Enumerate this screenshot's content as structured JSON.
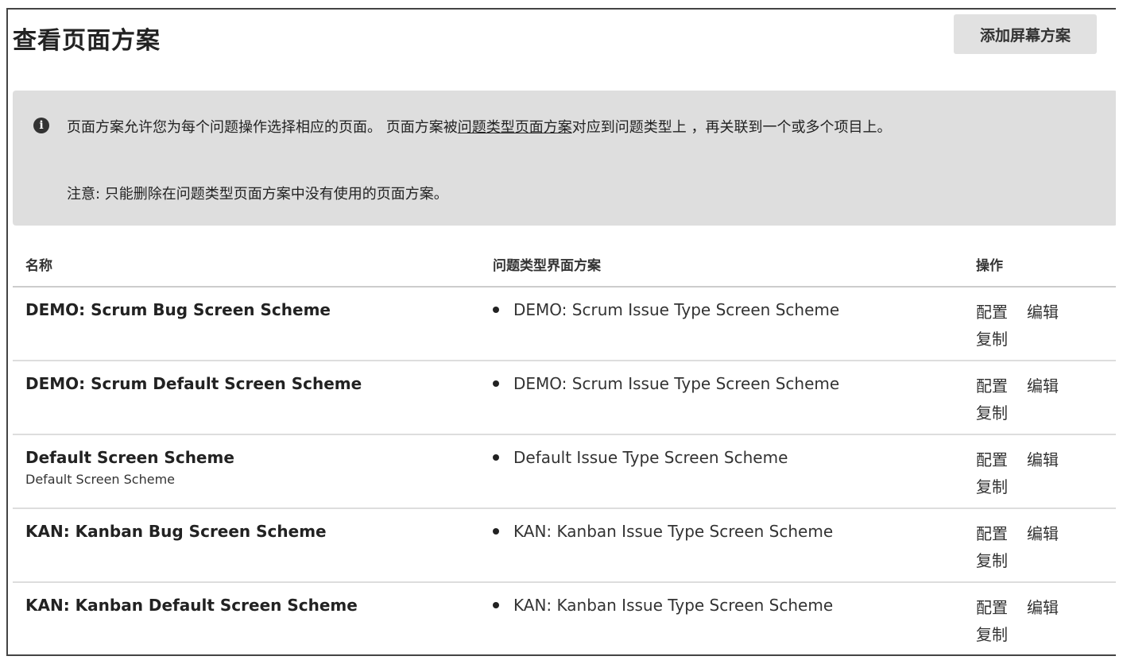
{
  "header": {
    "title": "查看页面方案",
    "add_button_label": "添加屏幕方案"
  },
  "notice": {
    "icon": "info-icon",
    "text_before_link": "页面方案允许您为每个问题操作选择相应的页面。 页面方案被",
    "link_text": "问题类型页面方案",
    "text_after_link": "对应到问题类型上 ，再关联到一个或多个项目上。",
    "note": "注意: 只能删除在问题类型页面方案中没有使用的页面方案。"
  },
  "table": {
    "headers": [
      "名称",
      "问题类型界面方案",
      "操作"
    ],
    "rows": [
      {
        "name": "DEMO: Scrum Bug Screen Scheme",
        "description": "",
        "issue_type_scheme": "DEMO: Scrum Issue Type Screen Scheme",
        "ops": [
          "配置",
          "编辑",
          "复制"
        ]
      },
      {
        "name": "DEMO: Scrum Default Screen Scheme",
        "description": "",
        "issue_type_scheme": "DEMO: Scrum Issue Type Screen Scheme",
        "ops": [
          "配置",
          "编辑",
          "复制"
        ]
      },
      {
        "name": "Default Screen Scheme",
        "description": "Default Screen Scheme",
        "issue_type_scheme": "Default Issue Type Screen Scheme",
        "ops": [
          "配置",
          "编辑",
          "复制"
        ]
      },
      {
        "name": "KAN: Kanban Bug Screen Scheme",
        "description": "",
        "issue_type_scheme": "KAN: Kanban Issue Type Screen Scheme",
        "ops": [
          "配置",
          "编辑",
          "复制"
        ]
      },
      {
        "name": "KAN: Kanban Default Screen Scheme",
        "description": "",
        "issue_type_scheme": "KAN: Kanban Issue Type Screen Scheme",
        "ops": [
          "配置",
          "编辑",
          "复制"
        ]
      }
    ]
  }
}
